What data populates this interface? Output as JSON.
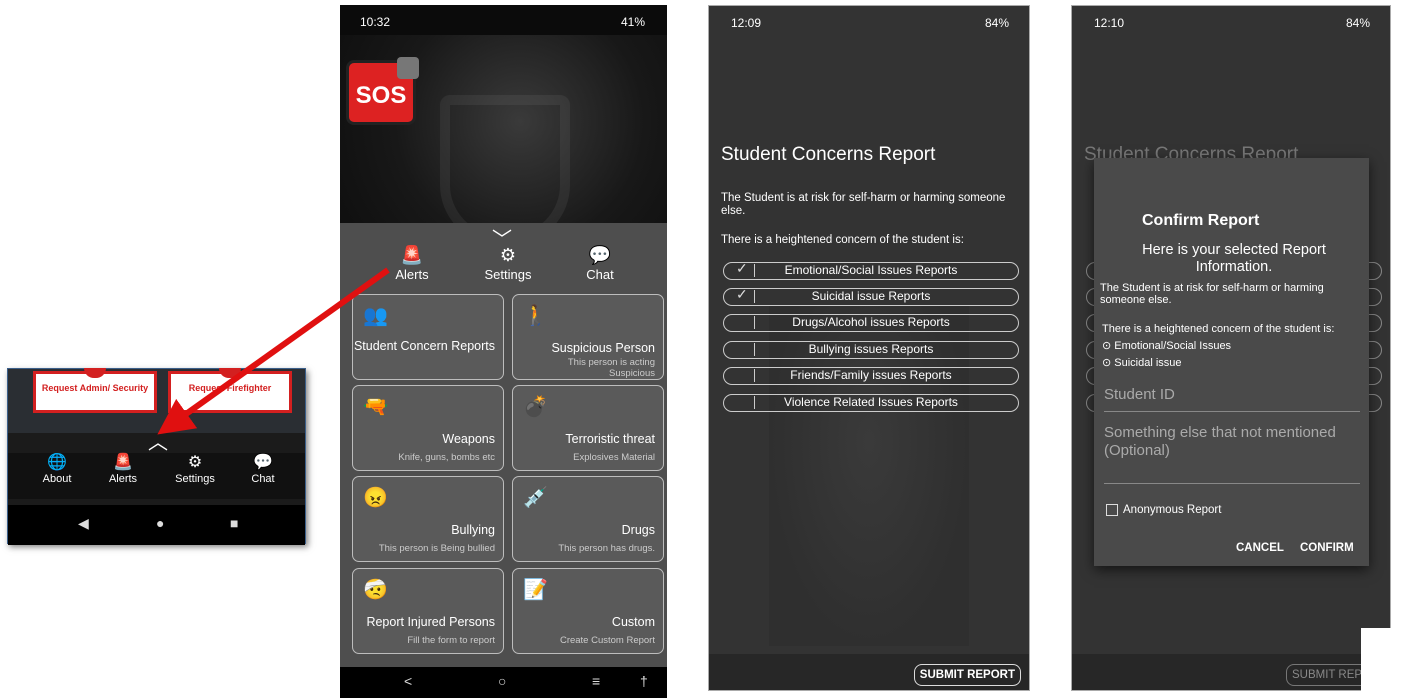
{
  "inset": {
    "buttons": [
      "Request Admin/ Security",
      "Request Firefighter"
    ],
    "nav": [
      {
        "icon": "globe-icon",
        "glyph": "🌐",
        "label": "About"
      },
      {
        "icon": "siren-icon",
        "glyph": "🚨",
        "label": "Alerts"
      },
      {
        "icon": "gear-icon",
        "glyph": "⚙",
        "label": "Settings"
      },
      {
        "icon": "chat-icon",
        "glyph": "💬",
        "label": "Chat"
      }
    ],
    "sysnav": [
      "◀",
      "●",
      "■"
    ]
  },
  "phone2": {
    "status_time": "10:32",
    "status_right": "41%",
    "sos_label": "SOS",
    "tabs": [
      {
        "icon": "siren-icon",
        "glyph": "🚨",
        "label": "Alerts"
      },
      {
        "icon": "gear-icon",
        "glyph": "⚙",
        "label": "Settings"
      },
      {
        "icon": "chat-icon",
        "glyph": "💬",
        "label": "Chat"
      }
    ],
    "cards": [
      {
        "icon": "meeting-icon",
        "glyph": "👥",
        "title": "Student Concern Reports",
        "sub": ""
      },
      {
        "icon": "person-icon",
        "glyph": "🚶",
        "title": "Suspicious Person",
        "sub": "This person is acting Suspicious"
      },
      {
        "icon": "gun-icon",
        "glyph": "🔫",
        "title": "Weapons",
        "sub": "Knife, guns, bombs etc"
      },
      {
        "icon": "grenade-icon",
        "glyph": "💣",
        "title": "Terroristic threat",
        "sub": "Explosives Material"
      },
      {
        "icon": "bully-icon",
        "glyph": "😠",
        "title": "Bullying",
        "sub": "This person is Being bullied"
      },
      {
        "icon": "syringe-icon",
        "glyph": "💉",
        "title": "Drugs",
        "sub": "This person has drugs."
      },
      {
        "icon": "injured-icon",
        "glyph": "🤕",
        "title": "Report Injured Persons",
        "sub": "Fill the form to report"
      },
      {
        "icon": "edit-doc-icon",
        "glyph": "📝",
        "title": "Custom",
        "sub": "Create Custom Report"
      }
    ],
    "sysnav": [
      "<",
      "○",
      "≡",
      "†"
    ]
  },
  "phone3": {
    "status_time": "12:09",
    "status_right": "84%",
    "title": "Student Concerns Report",
    "desc": "The Student is at risk for self-harm or harming someone else.",
    "subdesc": "There is a heightened concern of the student is:",
    "reports": [
      {
        "label": "Emotional/Social Issues Reports",
        "checked": true
      },
      {
        "label": "Suicidal issue Reports",
        "checked": true
      },
      {
        "label": "Drugs/Alcohol issues Reports",
        "checked": false
      },
      {
        "label": "Bullying issues Reports",
        "checked": false
      },
      {
        "label": "Friends/Family issues Reports",
        "checked": false
      },
      {
        "label": "Violence Related Issues Reports",
        "checked": false
      }
    ],
    "submit": "SUBMIT REPORT"
  },
  "phone4": {
    "status_time": "12:10",
    "status_right": "84%",
    "bg_title": "Student Concerns Report",
    "dialog": {
      "title": "Confirm Report",
      "subtitle": "Here is your selected Report Information.",
      "desc": "The Student is at risk for self-harm or harming someone else.",
      "subdesc": "There is a heightened concern of the student is:",
      "items": [
        "Emotional/Social Issues",
        "Suicidal issue"
      ],
      "student_id_placeholder": "Student ID",
      "other_placeholder": "Something else that not mentioned (Optional)",
      "anon_label": "Anonymous Report",
      "cancel": "CANCEL",
      "confirm": "CONFIRM"
    },
    "submit": "SUBMIT REPO"
  },
  "colors": {
    "accent_red": "#d32020",
    "panel_gray": "#4e4e4e",
    "arrow_red": "#e01010"
  }
}
